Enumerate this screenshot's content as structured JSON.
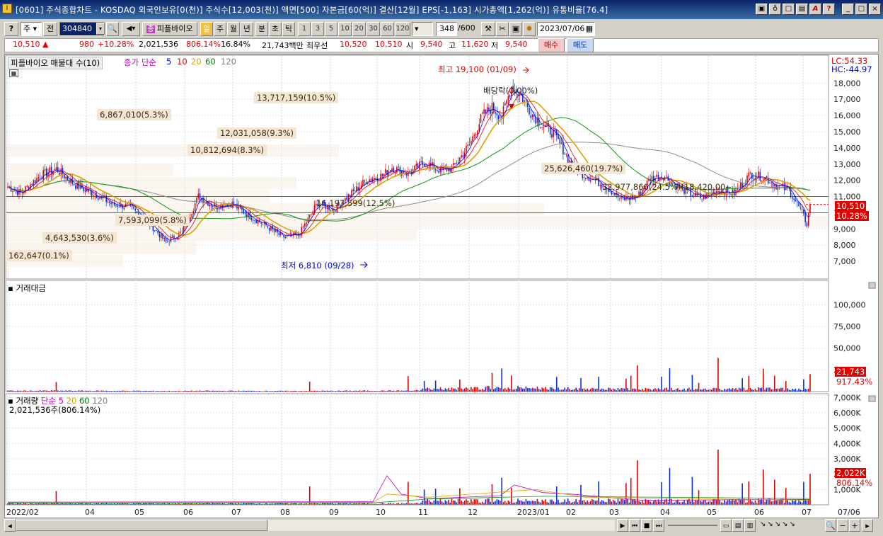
{
  "window": {
    "title": "[0601] 주식종합차트 - KOSDAQ 외국인보유[0(천)] 주식수[12,003(천)] 액면[500] 자본금[60(억)] 결산[12월] EPS[-1,163] 시가총액[1,262(억)] 유통비율[76.4]",
    "buttons": [
      "▣",
      "♁",
      "□",
      "▤",
      "A",
      "?",
      "_",
      "□",
      "×"
    ]
  },
  "toolbar": {
    "market_label": "주",
    "prev_label": "전",
    "code": "304840",
    "stock_name": "피플바이오",
    "periods": [
      "일",
      "주",
      "월",
      "년",
      "분",
      "초",
      "틱"
    ],
    "active_period": "일",
    "intervals": [
      "1",
      "3",
      "5",
      "10",
      "20",
      "30",
      "60",
      "120"
    ],
    "count": "348",
    "count_total": "/600",
    "date": "2023/07/06"
  },
  "quote": {
    "price": "10,510",
    "change": "980",
    "change_pct": "+10.28%",
    "volume": "2,021,536",
    "vol_ratio": "806.14%",
    "turnover": "16.84%",
    "amount": "21,743백만",
    "best_ask_label": "최우선",
    "best_ask": "10,520",
    "best_bid": "10,510",
    "open_label": "시",
    "open": "9,540",
    "high_label": "고",
    "high": "11,620",
    "low_label": "저",
    "low": "9,540",
    "buy_label": "매수",
    "sell_label": "매도"
  },
  "price_panel": {
    "title": "피플바이오 매물대 수(10)",
    "ma_label": "종가 단순",
    "ma_periods": [
      "5",
      "10",
      "20",
      "60",
      "120"
    ],
    "ma_colors": [
      "#0000ff",
      "#e00000",
      "#e0a000",
      "#008000",
      "#808080"
    ],
    "lc": "LC:54.33",
    "hc": "HC:-44.97",
    "high_note": "최고 19,100 (01/09)",
    "low_note": "최저 6,810 (09/28)",
    "dividend_note": "배당락(0.00%)",
    "last_price": "10,510",
    "last_pct": "10.28%",
    "yticks": [
      "18,000",
      "17,000",
      "16,000",
      "15,000",
      "14,000",
      "13,000",
      "12,000",
      "11,000",
      "10,000",
      "9,000",
      "8,000",
      "7,000"
    ],
    "volume_profile": [
      "13,717,159(10.5%)",
      "6,867,010(5.3%)",
      "12,031,058(9.3%)",
      "10,812,694(8.3%)",
      "25,626,460(19.7%)",
      "32,977,866(24.5%)(18,420,00~",
      "16,197,599(12.5%)",
      "7,593,099(5.8%)",
      "4,643,530(3.6%)",
      "162,647(0.1%)"
    ]
  },
  "amount_panel": {
    "title": "거래대금",
    "yticks": [
      "100,000",
      "75,000",
      "50,000",
      "25,000"
    ],
    "last": "21,743",
    "last_pct": "917.43%"
  },
  "volume_panel": {
    "title": "거래량",
    "ma_label": "단순",
    "ma_periods": [
      "5",
      "20",
      "60",
      "120"
    ],
    "value": "2,021,536주(806.14%)",
    "yticks": [
      "7,000K",
      "6,000K",
      "5,000K",
      "4,000K",
      "3,000K",
      "2,000K",
      "1,000K"
    ],
    "last": "2,022K",
    "last_pct": "806.14%"
  },
  "xaxis": {
    "labels": [
      "2022/02",
      "04",
      "05",
      "06",
      "07",
      "08",
      "09",
      "10",
      "11",
      "12",
      "2023/01",
      "02",
      "03",
      "04",
      "05",
      "06",
      "07"
    ],
    "right_label": "07/06"
  },
  "chart_data": {
    "type": "candlestick",
    "price_anchors": [
      [
        0,
        11600
      ],
      [
        8,
        11200
      ],
      [
        20,
        12300
      ],
      [
        30,
        12700
      ],
      [
        42,
        11700
      ],
      [
        55,
        11100
      ],
      [
        65,
        10500
      ],
      [
        75,
        10400
      ],
      [
        88,
        9300
      ],
      [
        98,
        8200
      ],
      [
        108,
        8800
      ],
      [
        118,
        11000
      ],
      [
        128,
        10400
      ],
      [
        138,
        10600
      ],
      [
        150,
        9800
      ],
      [
        160,
        9200
      ],
      [
        170,
        8500
      ],
      [
        180,
        8600
      ],
      [
        192,
        10600
      ],
      [
        202,
        10200
      ],
      [
        212,
        11100
      ],
      [
        222,
        12000
      ],
      [
        232,
        12300
      ],
      [
        238,
        12800
      ],
      [
        248,
        12400
      ],
      [
        258,
        13100
      ],
      [
        268,
        12600
      ],
      [
        276,
        12800
      ],
      [
        286,
        14200
      ],
      [
        294,
        16000
      ],
      [
        300,
        16500
      ],
      [
        306,
        15900
      ],
      [
        312,
        17800
      ],
      [
        318,
        17200
      ],
      [
        324,
        16200
      ],
      [
        330,
        15500
      ],
      [
        338,
        14900
      ],
      [
        344,
        13900
      ],
      [
        350,
        12800
      ],
      [
        356,
        12400
      ],
      [
        362,
        12100
      ],
      [
        372,
        11500
      ],
      [
        380,
        10800
      ],
      [
        390,
        11000
      ],
      [
        398,
        12100
      ],
      [
        406,
        12300
      ],
      [
        414,
        11700
      ],
      [
        422,
        11200
      ],
      [
        430,
        10900
      ],
      [
        440,
        11400
      ],
      [
        450,
        11200
      ],
      [
        460,
        12400
      ],
      [
        468,
        12200
      ],
      [
        476,
        11700
      ],
      [
        484,
        11400
      ],
      [
        492,
        10000
      ],
      [
        495,
        9300
      ],
      [
        497,
        10510
      ]
    ],
    "high": 19100,
    "low": 6810,
    "last": 10510,
    "ylim": [
      6000,
      18800
    ],
    "amount_ylim": [
      0,
      115000
    ],
    "volume_ylim_k": [
      0,
      7200
    ],
    "volume_spikes_k": {
      "30": 900,
      "187": 1200,
      "248": 1500,
      "258": 1000,
      "265": 1050,
      "300": 1350,
      "312": 1100,
      "340": 1200,
      "355": 1300,
      "390": 2900,
      "410": 2400,
      "428": 950,
      "440": 3600,
      "455": 1400,
      "468": 2300,
      "482": 1100,
      "497": 2022
    }
  }
}
